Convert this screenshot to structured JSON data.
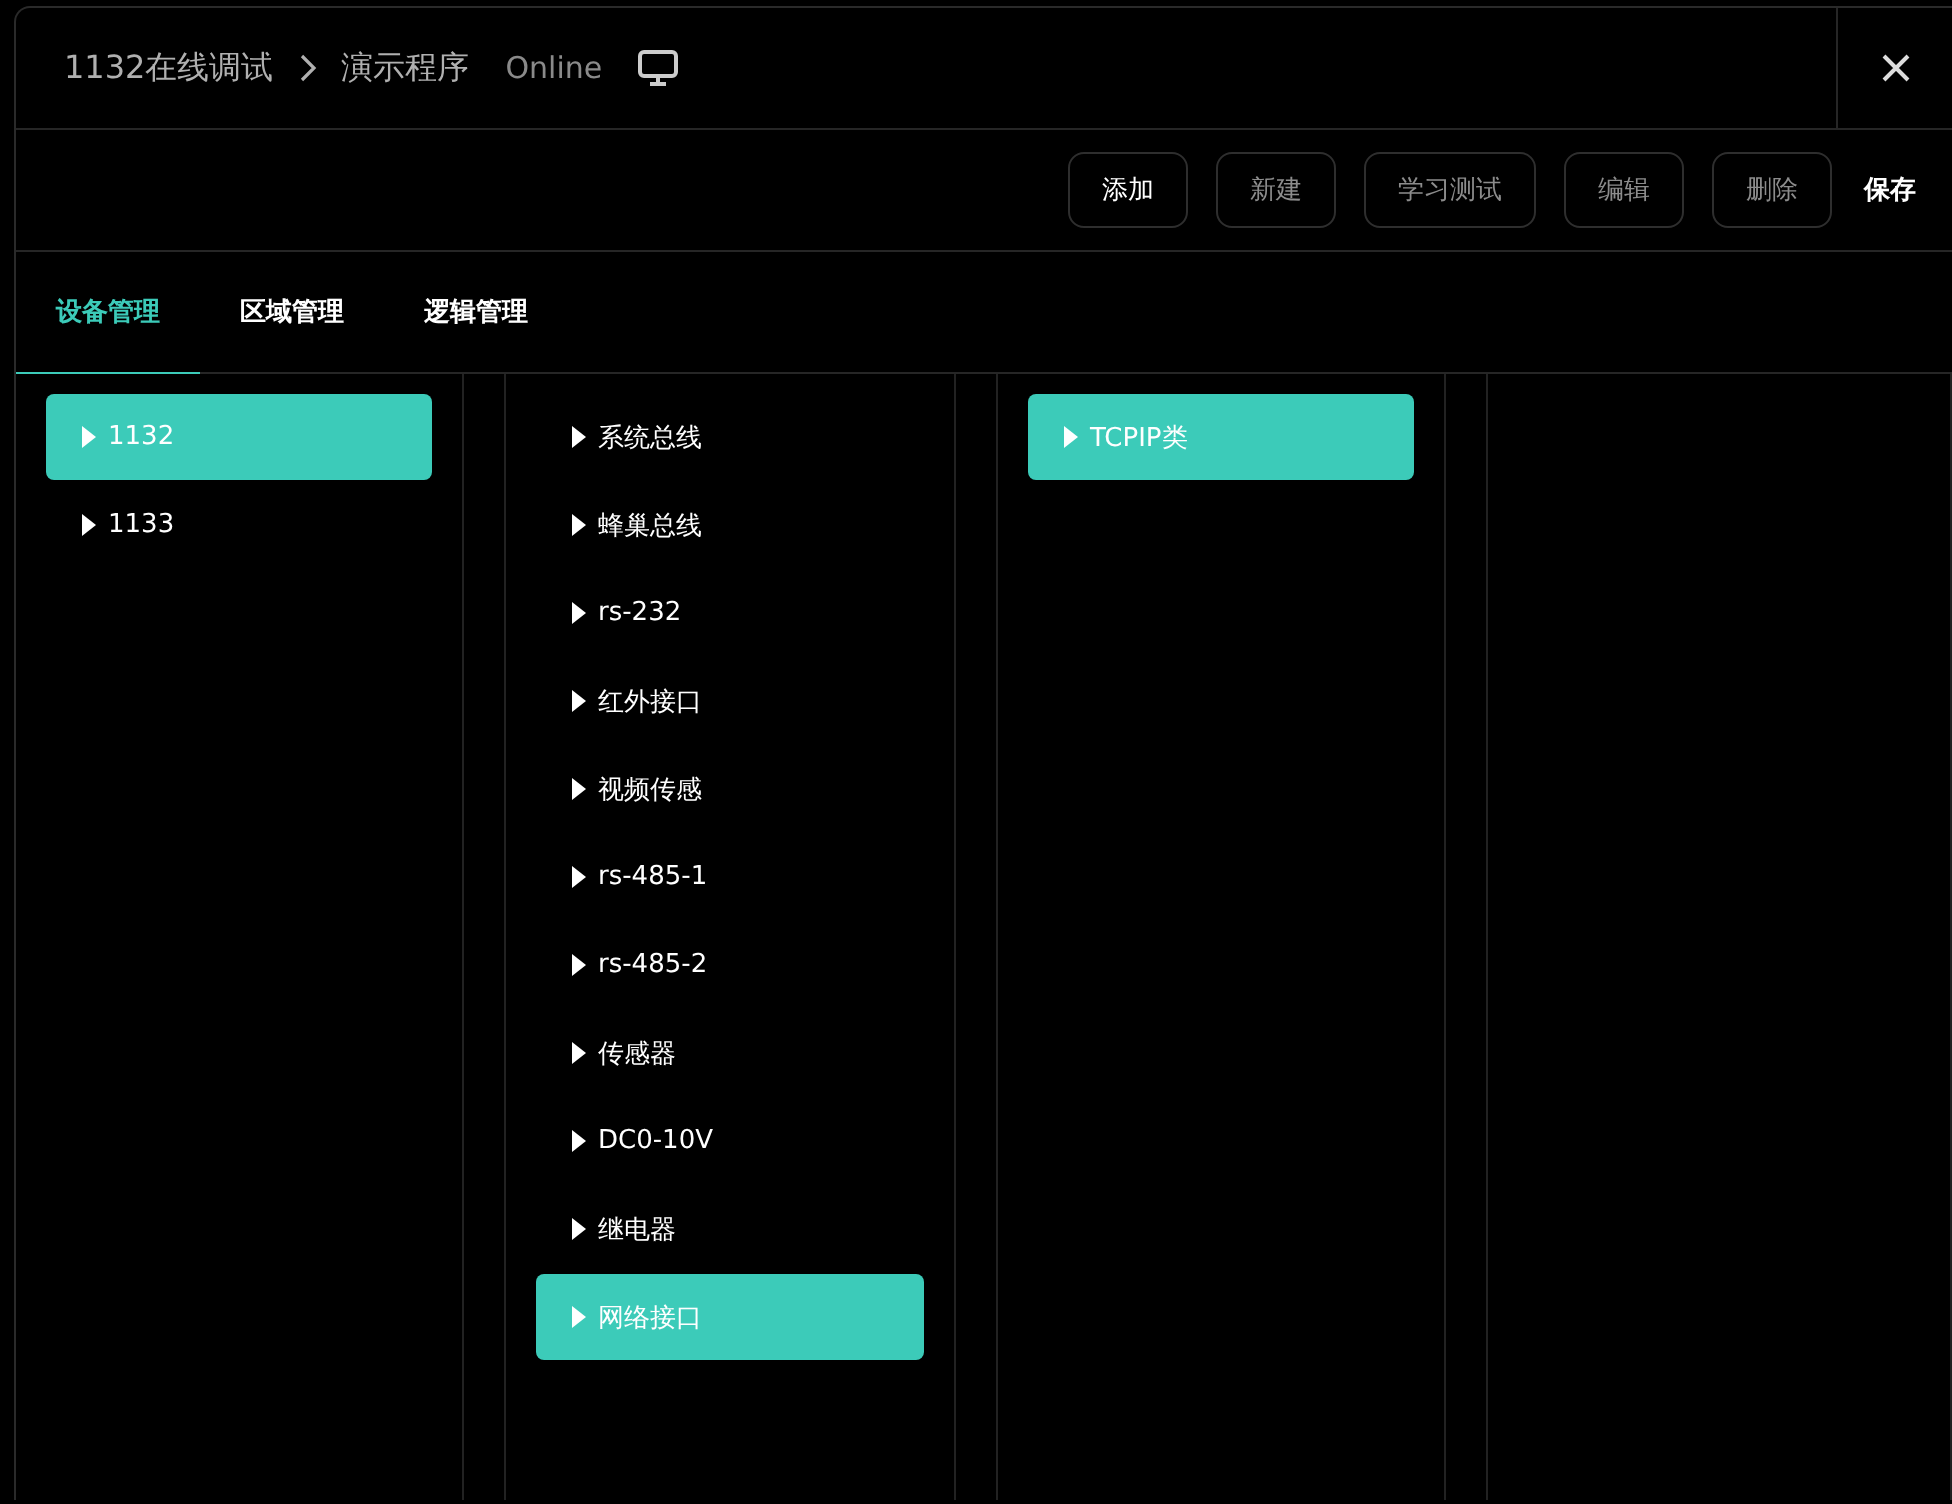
{
  "header": {
    "breadcrumb": [
      {
        "label": "1132在线调试"
      },
      {
        "label": "演示程序"
      }
    ],
    "status": "Online"
  },
  "toolbar": [
    {
      "label": "添加",
      "kind": "outlined",
      "disabled": false
    },
    {
      "label": "新建",
      "kind": "outlined",
      "disabled": true
    },
    {
      "label": "学习测试",
      "kind": "outlined",
      "disabled": true
    },
    {
      "label": "编辑",
      "kind": "outlined",
      "disabled": true
    },
    {
      "label": "删除",
      "kind": "outlined",
      "disabled": true
    },
    {
      "label": "保存",
      "kind": "plain",
      "disabled": false
    }
  ],
  "tabs": [
    {
      "label": "设备管理",
      "selected": true
    },
    {
      "label": "区域管理",
      "selected": false
    },
    {
      "label": "逻辑管理",
      "selected": false
    }
  ],
  "columns": [
    {
      "items": [
        {
          "label": "1132",
          "selected": true
        },
        {
          "label": "1133",
          "selected": false
        }
      ]
    },
    {
      "items": [
        {
          "label": "系统总线",
          "selected": false
        },
        {
          "label": "蜂巢总线",
          "selected": false
        },
        {
          "label": "rs-232",
          "selected": false
        },
        {
          "label": "红外接口",
          "selected": false
        },
        {
          "label": "视频传感",
          "selected": false
        },
        {
          "label": "rs-485-1",
          "selected": false
        },
        {
          "label": "rs-485-2",
          "selected": false
        },
        {
          "label": "传感器",
          "selected": false
        },
        {
          "label": "DC0-10V",
          "selected": false
        },
        {
          "label": "继电器",
          "selected": false
        },
        {
          "label": "网络接口",
          "selected": true
        }
      ]
    },
    {
      "items": [
        {
          "label": "TCPIP类",
          "selected": true
        }
      ]
    },
    {}
  ]
}
